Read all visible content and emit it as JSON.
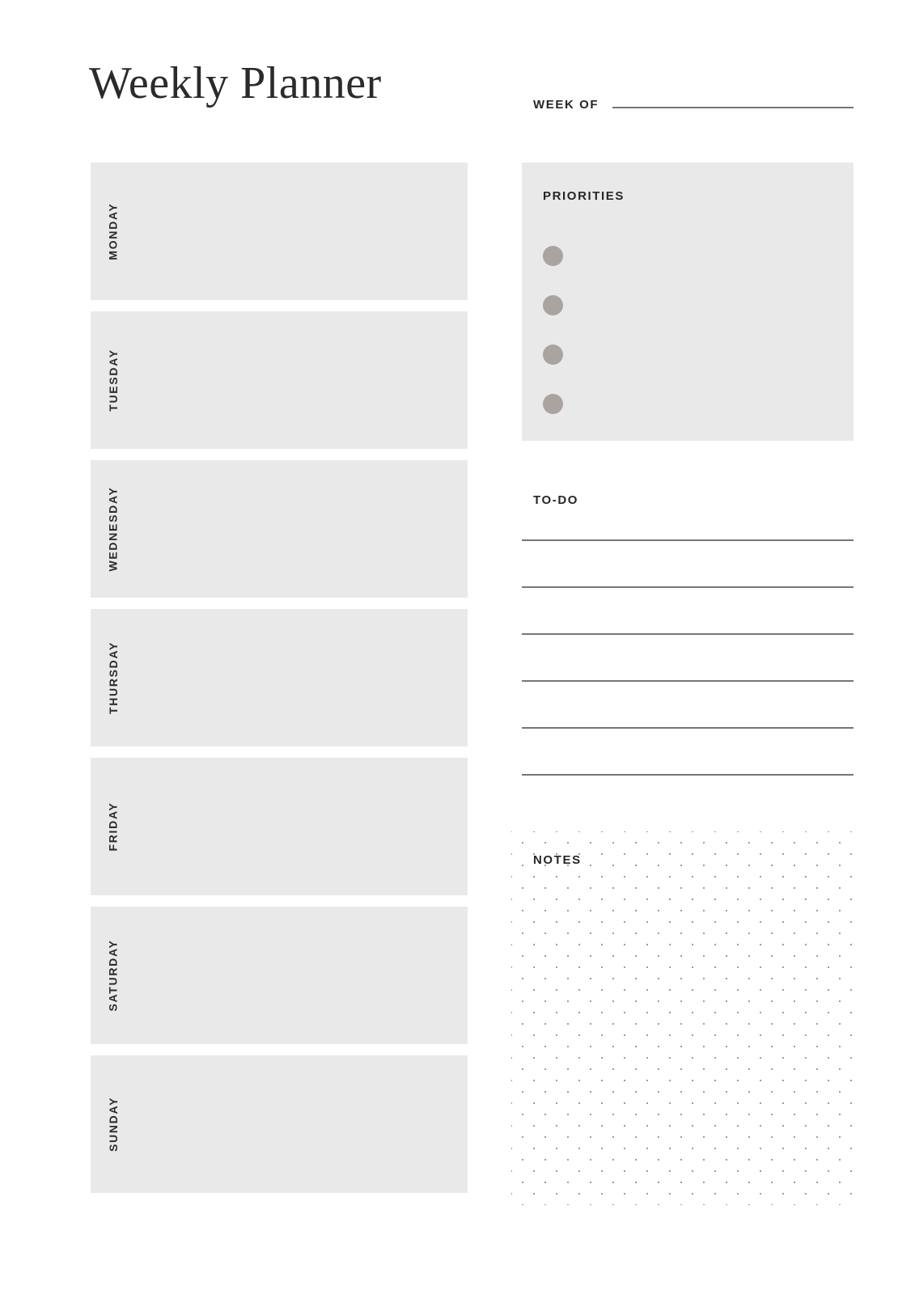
{
  "page": {
    "title": "Weekly Planner",
    "background_color": "#ffffff",
    "block_color": "#e9e9e9",
    "accent_color": "#aaa3a0",
    "rule_color": "#7b7472",
    "text_color": "#262626"
  },
  "header": {
    "title": "Weekly Planner",
    "week_of_label": "WEEK OF",
    "week_of_value": ""
  },
  "days": [
    {
      "label": "MONDAY",
      "value": ""
    },
    {
      "label": "TUESDAY",
      "value": ""
    },
    {
      "label": "WEDNESDAY",
      "value": ""
    },
    {
      "label": "THURSDAY",
      "value": ""
    },
    {
      "label": "FRIDAY",
      "value": ""
    },
    {
      "label": "SATURDAY",
      "value": ""
    },
    {
      "label": "SUNDAY",
      "value": ""
    }
  ],
  "priorities": {
    "title": "PRIORITIES",
    "bullet_count": 4,
    "items": [
      {
        "value": ""
      },
      {
        "value": ""
      },
      {
        "value": ""
      },
      {
        "value": ""
      }
    ]
  },
  "todo": {
    "title": "TO-DO",
    "line_count": 6,
    "items": [
      {
        "value": ""
      },
      {
        "value": ""
      },
      {
        "value": ""
      },
      {
        "value": ""
      },
      {
        "value": ""
      },
      {
        "value": ""
      }
    ]
  },
  "notes": {
    "title": "NOTES",
    "value": "",
    "pattern": "dot-grid"
  }
}
